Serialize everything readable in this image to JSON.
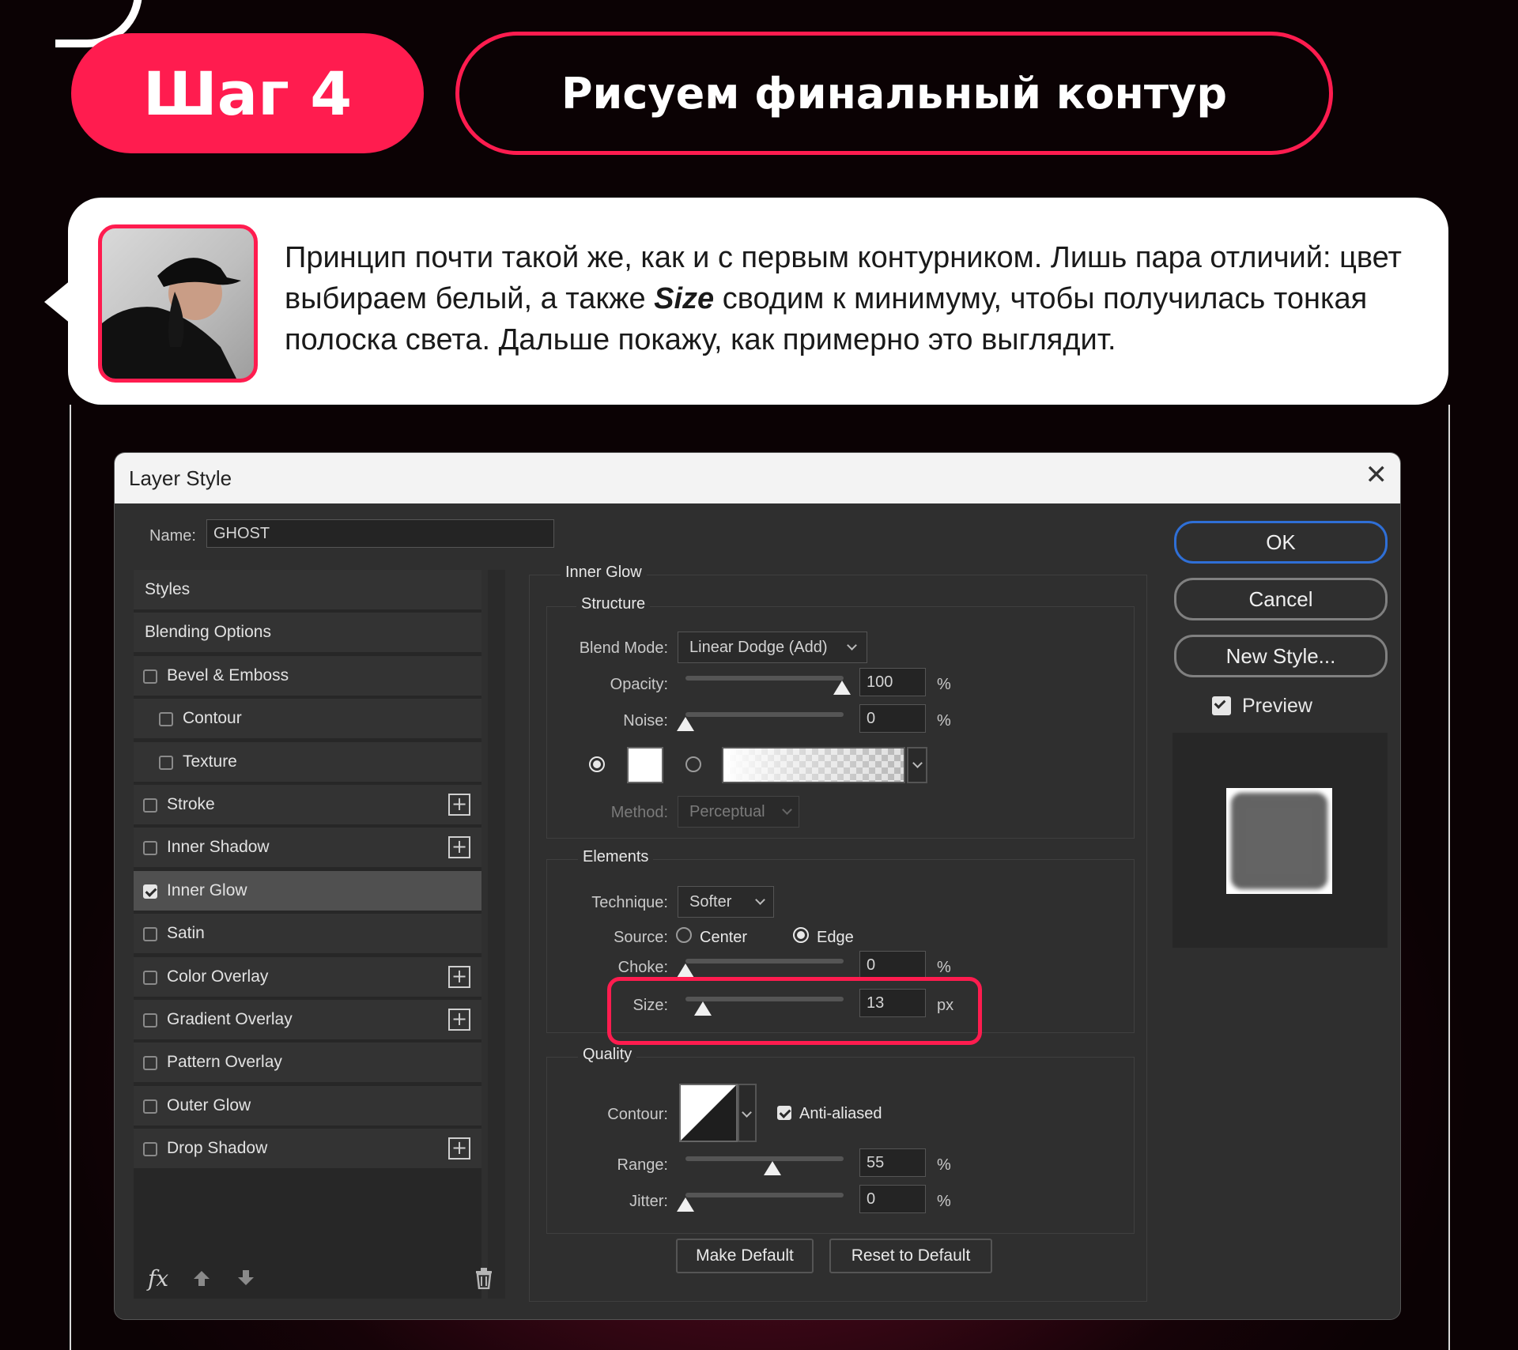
{
  "header": {
    "step_label": "Шаг 4",
    "title": "Рисуем финальный контур"
  },
  "bubble": {
    "text_before": "Принцип почти такой же, как и с первым контурником. Лишь пара отличий: цвет выбираем белый, а также ",
    "text_emphasis": "Size",
    "text_after": " сводим к минимуму, чтобы получилась тонкая полоска света. Дальше покажу, как примерно это выглядит."
  },
  "dialog": {
    "title": "Layer Style",
    "close": "✕",
    "name_label": "Name:",
    "name_value": "GHOST",
    "styles_list": [
      {
        "label": "Styles",
        "checkbox": false,
        "plus": false,
        "indent": 0,
        "selected": false
      },
      {
        "label": "Blending Options",
        "checkbox": false,
        "plus": false,
        "indent": 0,
        "selected": false
      },
      {
        "label": "Bevel & Emboss",
        "checkbox": true,
        "checked": false,
        "plus": false,
        "indent": 0,
        "selected": false
      },
      {
        "label": "Contour",
        "checkbox": true,
        "checked": false,
        "plus": false,
        "indent": 1,
        "selected": false
      },
      {
        "label": "Texture",
        "checkbox": true,
        "checked": false,
        "plus": false,
        "indent": 1,
        "selected": false
      },
      {
        "label": "Stroke",
        "checkbox": true,
        "checked": false,
        "plus": true,
        "indent": 0,
        "selected": false
      },
      {
        "label": "Inner Shadow",
        "checkbox": true,
        "checked": false,
        "plus": true,
        "indent": 0,
        "selected": false
      },
      {
        "label": "Inner Glow",
        "checkbox": true,
        "checked": true,
        "plus": false,
        "indent": 0,
        "selected": true
      },
      {
        "label": "Satin",
        "checkbox": true,
        "checked": false,
        "plus": false,
        "indent": 0,
        "selected": false
      },
      {
        "label": "Color Overlay",
        "checkbox": true,
        "checked": false,
        "plus": true,
        "indent": 0,
        "selected": false
      },
      {
        "label": "Gradient Overlay",
        "checkbox": true,
        "checked": false,
        "plus": true,
        "indent": 0,
        "selected": false
      },
      {
        "label": "Pattern Overlay",
        "checkbox": true,
        "checked": false,
        "plus": false,
        "indent": 0,
        "selected": false
      },
      {
        "label": "Outer Glow",
        "checkbox": true,
        "checked": false,
        "plus": false,
        "indent": 0,
        "selected": false
      },
      {
        "label": "Drop Shadow",
        "checkbox": true,
        "checked": false,
        "plus": true,
        "indent": 0,
        "selected": false
      }
    ],
    "footer_icons": [
      "fx-icon",
      "arrow-up-icon",
      "arrow-down-icon",
      "trash-icon"
    ],
    "fx_label": "fx",
    "inner_glow": {
      "section_title": "Inner Glow",
      "structure_title": "Structure",
      "blend_mode_label": "Blend Mode:",
      "blend_mode_value": "Linear Dodge (Add)",
      "opacity_label": "Opacity:",
      "opacity_value": "100",
      "opacity_unit": "%",
      "noise_label": "Noise:",
      "noise_value": "0",
      "noise_unit": "%",
      "method_label": "Method:",
      "method_value": "Perceptual",
      "elements_title": "Elements",
      "technique_label": "Technique:",
      "technique_value": "Softer",
      "source_label": "Source:",
      "source_center": "Center",
      "source_edge": "Edge",
      "choke_label": "Choke:",
      "choke_value": "0",
      "choke_unit": "%",
      "size_label": "Size:",
      "size_value": "13",
      "size_unit": "px",
      "quality_title": "Quality",
      "contour_label": "Contour:",
      "anti_aliased_label": "Anti-aliased",
      "range_label": "Range:",
      "range_value": "55",
      "range_unit": "%",
      "jitter_label": "Jitter:",
      "jitter_value": "0",
      "jitter_unit": "%",
      "make_default": "Make Default",
      "reset_default": "Reset to Default"
    },
    "buttons": {
      "ok": "OK",
      "cancel": "Cancel",
      "new_style": "New Style...",
      "preview": "Preview"
    }
  },
  "colors": {
    "accent": "#ff1c4f",
    "dialog_bg": "#2f2f2f",
    "ok_border": "#2f6fd6"
  }
}
